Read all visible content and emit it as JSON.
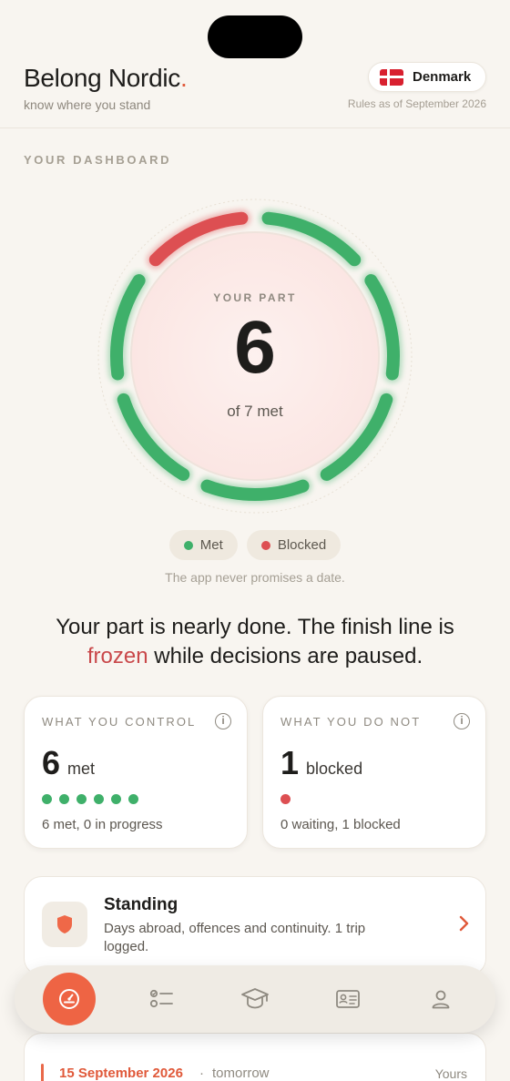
{
  "header": {
    "brand": "Belong Nordic",
    "brand_dot": ".",
    "tagline": "know where you stand",
    "country": "Denmark",
    "rules": "Rules as of September 2026"
  },
  "dashboard": {
    "section_label": "YOUR DASHBOARD",
    "ring": {
      "label": "YOUR PART",
      "value": "6",
      "sub": "of 7 met",
      "met": 6,
      "blocked": 1,
      "total": 7
    },
    "legend": {
      "met": "Met",
      "blocked": "Blocked"
    },
    "note": "The app never promises a date.",
    "headline_a": "Your part is nearly done. The finish line is",
    "headline_frozen": "frozen",
    "headline_b": "while decisions are paused."
  },
  "cards": {
    "control": {
      "title": "WHAT YOU CONTROL",
      "value": "6",
      "unit": "met",
      "sub": "6 met, 0 in progress",
      "dot_count": 6
    },
    "not_control": {
      "title": "WHAT YOU DO NOT",
      "value": "1",
      "unit": "blocked",
      "sub": "0 waiting, 1 blocked",
      "dot_count": 1
    }
  },
  "standing": {
    "title": "Standing",
    "desc": "Days abroad, offences and continuity. 1 trip logged."
  },
  "upcoming": {
    "date": "15 September 2026",
    "separator": "·",
    "when": "tomorrow",
    "who": "Yours"
  },
  "tabs": [
    "dashboard-icon",
    "checklist-icon",
    "graduation-cap-icon",
    "id-card-icon",
    "profile-icon"
  ],
  "colors": {
    "accent": "#ee6444",
    "met": "#3fb06a",
    "blocked": "#dd4f52"
  }
}
